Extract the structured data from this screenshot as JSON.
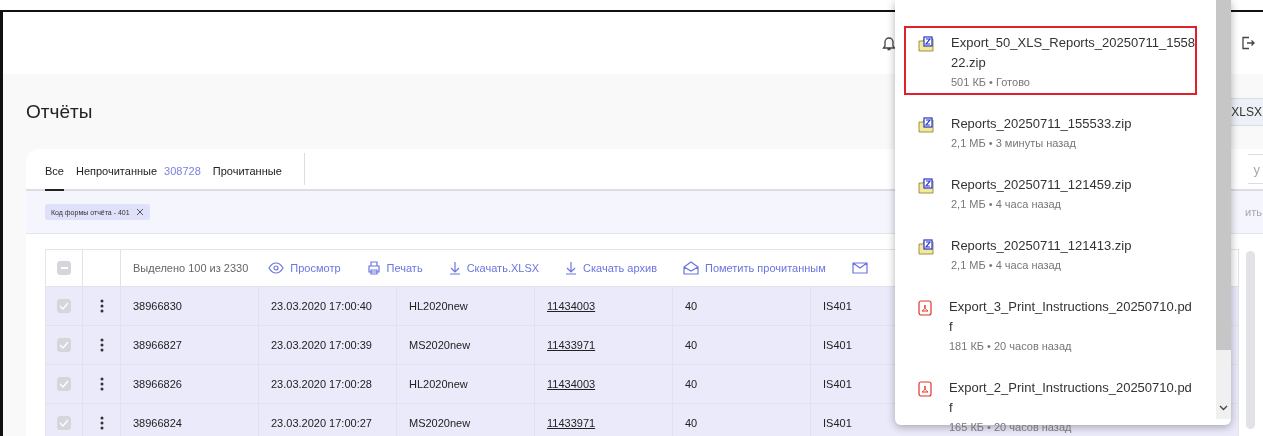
{
  "page_title": "Отчёты",
  "title_button_fragment": "XLSX",
  "tabs": [
    {
      "label": "Все",
      "selected": true
    },
    {
      "label": "Непрочитанные",
      "count": "308728",
      "selected": false
    },
    {
      "label": "Прочитанные",
      "selected": false
    }
  ],
  "search_fragment": "у",
  "filter_chip": "Код формы отчёта - 401",
  "filter_action_fragment": "ить",
  "table": {
    "select_all_indeterminate": true,
    "selection_summary": "Выделено 100 из 2330",
    "actions": [
      {
        "kind": "view",
        "label": "Просмотр"
      },
      {
        "kind": "print",
        "label": "Печать"
      },
      {
        "kind": "download",
        "label": "Скачать.XLSX"
      },
      {
        "kind": "download",
        "label": "Скачать архив"
      },
      {
        "kind": "mark_read",
        "label": "Пометить прочитанным"
      },
      {
        "kind": "mail"
      }
    ],
    "rows": [
      {
        "checked": true,
        "id": "38966830",
        "date": "23.03.2020 17:00:40",
        "form": "HL2020new",
        "link": "11434003",
        "column_6": "40",
        "code": "IS401"
      },
      {
        "checked": true,
        "id": "38966827",
        "date": "23.03.2020 17:00:39",
        "form": "MS2020new",
        "link": "11433971",
        "column_6": "40",
        "code": "IS401"
      },
      {
        "checked": true,
        "id": "38966826",
        "date": "23.03.2020 17:00:28",
        "form": "HL2020new",
        "link": "11434003",
        "column_6": "40",
        "code": "IS401"
      },
      {
        "checked": true,
        "id": "38966824",
        "date": "23.03.2020 17:00:27",
        "form": "MS2020new",
        "link": "11433971",
        "column_6": "40",
        "code": "IS401"
      }
    ]
  },
  "downloads": [
    {
      "kind": "zip",
      "name": "Export_50_XLS_Reports_20250711_155822.zip",
      "status": "501 КБ • Готово",
      "selected": true
    },
    {
      "kind": "zip",
      "name": "Reports_20250711_155533.zip",
      "status": "2,1 МБ • 3 минуты назад",
      "selected": false
    },
    {
      "kind": "zip",
      "name": "Reports_20250711_121459.zip",
      "status": "2,1 МБ • 4 часа назад",
      "selected": false
    },
    {
      "kind": "zip",
      "name": "Reports_20250711_121413.zip",
      "status": "2,1 МБ • 4 часа назад",
      "selected": false
    },
    {
      "kind": "pdf",
      "name": "Export_3_Print_Instructions_20250710.pdf",
      "status": "181 КБ • 20 часов назад",
      "selected": false
    },
    {
      "kind": "pdf",
      "name": "Export_2_Print_Instructions_20250710.pdf",
      "status": "165 КБ • 20 часов назад",
      "selected": false
    }
  ]
}
